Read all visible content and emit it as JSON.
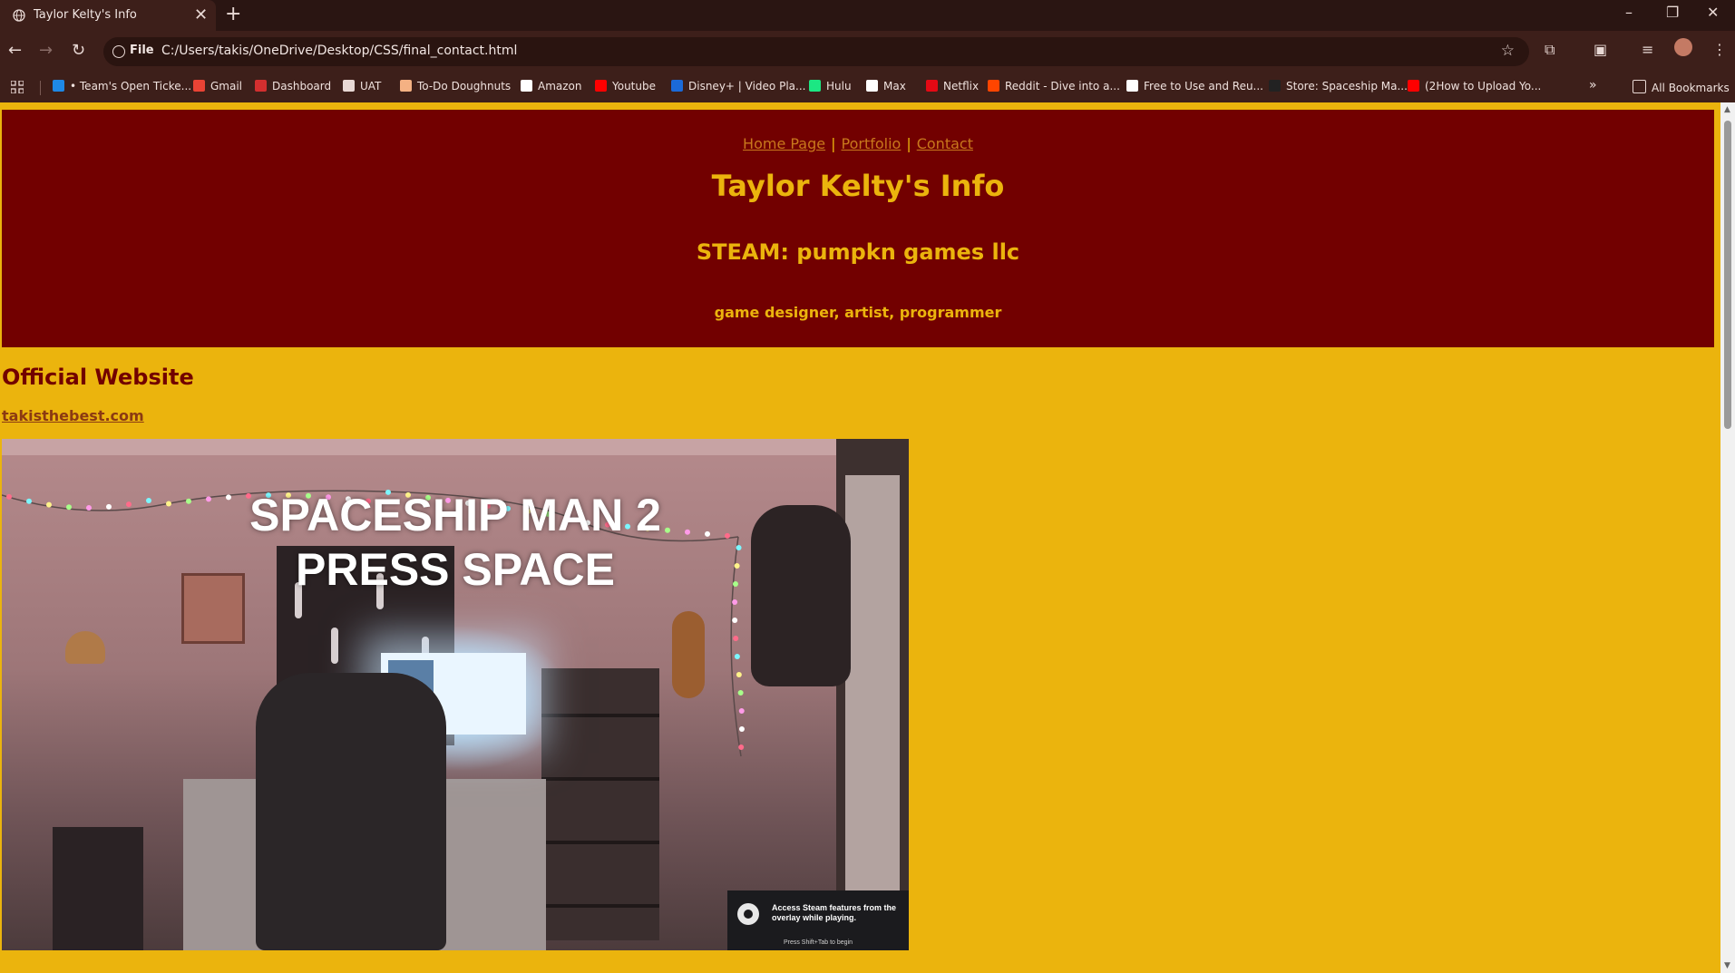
{
  "browser": {
    "tab_title": "Taylor Kelty's Info",
    "tab_close": "✕",
    "new_tab": "+",
    "url_scheme": "File",
    "url": "C:/Users/takis/OneDrive/Desktop/CSS/final_contact.html",
    "window_controls": {
      "minimize": "–",
      "maximize": "❐",
      "close": "✕"
    },
    "nav": {
      "back": "←",
      "forward": "→",
      "reload": "↻"
    },
    "bookmarks": [
      {
        "label": "• Team's Open Ticke...",
        "icon": "n-icon",
        "color": "#1e88e5"
      },
      {
        "label": "Gmail",
        "icon": "gmail-icon",
        "color": "#ea4335"
      },
      {
        "label": "Dashboard",
        "icon": "dashboard-icon",
        "color": "#d32f2f"
      },
      {
        "label": "UAT",
        "icon": "folder-icon",
        "color": "#e8d8d4"
      },
      {
        "label": "To-Do Doughnuts",
        "icon": "doughnut-icon",
        "color": "#f4b183"
      },
      {
        "label": "Amazon",
        "icon": "amazon-icon",
        "color": "#ffffff"
      },
      {
        "label": "Youtube",
        "icon": "youtube-icon",
        "color": "#ff0000"
      },
      {
        "label": "Disney+ | Video Pla...",
        "icon": "disney-icon",
        "color": "#1b6ad8"
      },
      {
        "label": "Hulu",
        "icon": "hulu-icon",
        "color": "#1ce783"
      },
      {
        "label": "Max",
        "icon": "max-icon",
        "color": "#ffffff"
      },
      {
        "label": "Netflix",
        "icon": "netflix-icon",
        "color": "#e50914"
      },
      {
        "label": "Reddit - Dive into a...",
        "icon": "reddit-icon",
        "color": "#ff4500"
      },
      {
        "label": "Free to Use and Reu...",
        "icon": "loc-icon",
        "color": "#ffffff"
      },
      {
        "label": "Store: Spaceship Ma...",
        "icon": "store-icon",
        "color": "#222222"
      },
      {
        "label": "(2How to Upload Yo...",
        "icon": "youtube-icon",
        "color": "#ff0000"
      }
    ],
    "more_bookmarks": "»",
    "all_bookmarks": "All Bookmarks"
  },
  "page": {
    "nav_links": [
      "Home Page",
      "Portfolio",
      "Contact"
    ],
    "nav_separator": "|",
    "title": "Taylor Kelty's Info",
    "subtitle": "STEAM: pumpkn games llc",
    "roles": "game designer, artist, programmer",
    "official_heading": "Official Website",
    "official_link": "takisthebest.com",
    "image": {
      "overlay_line1": "SPACESHIP MAN 2",
      "overlay_line2": "PRESS SPACE",
      "steam_message": "Access Steam features from the overlay while playing.",
      "steam_hint": "Press Shift+Tab to begin"
    }
  },
  "colors": {
    "page_bg": "#ebb40d",
    "header_bg": "#720000",
    "link": "#c8781c",
    "heading_text": "#ebb40d",
    "browser_frame": "#3d1f1a"
  }
}
